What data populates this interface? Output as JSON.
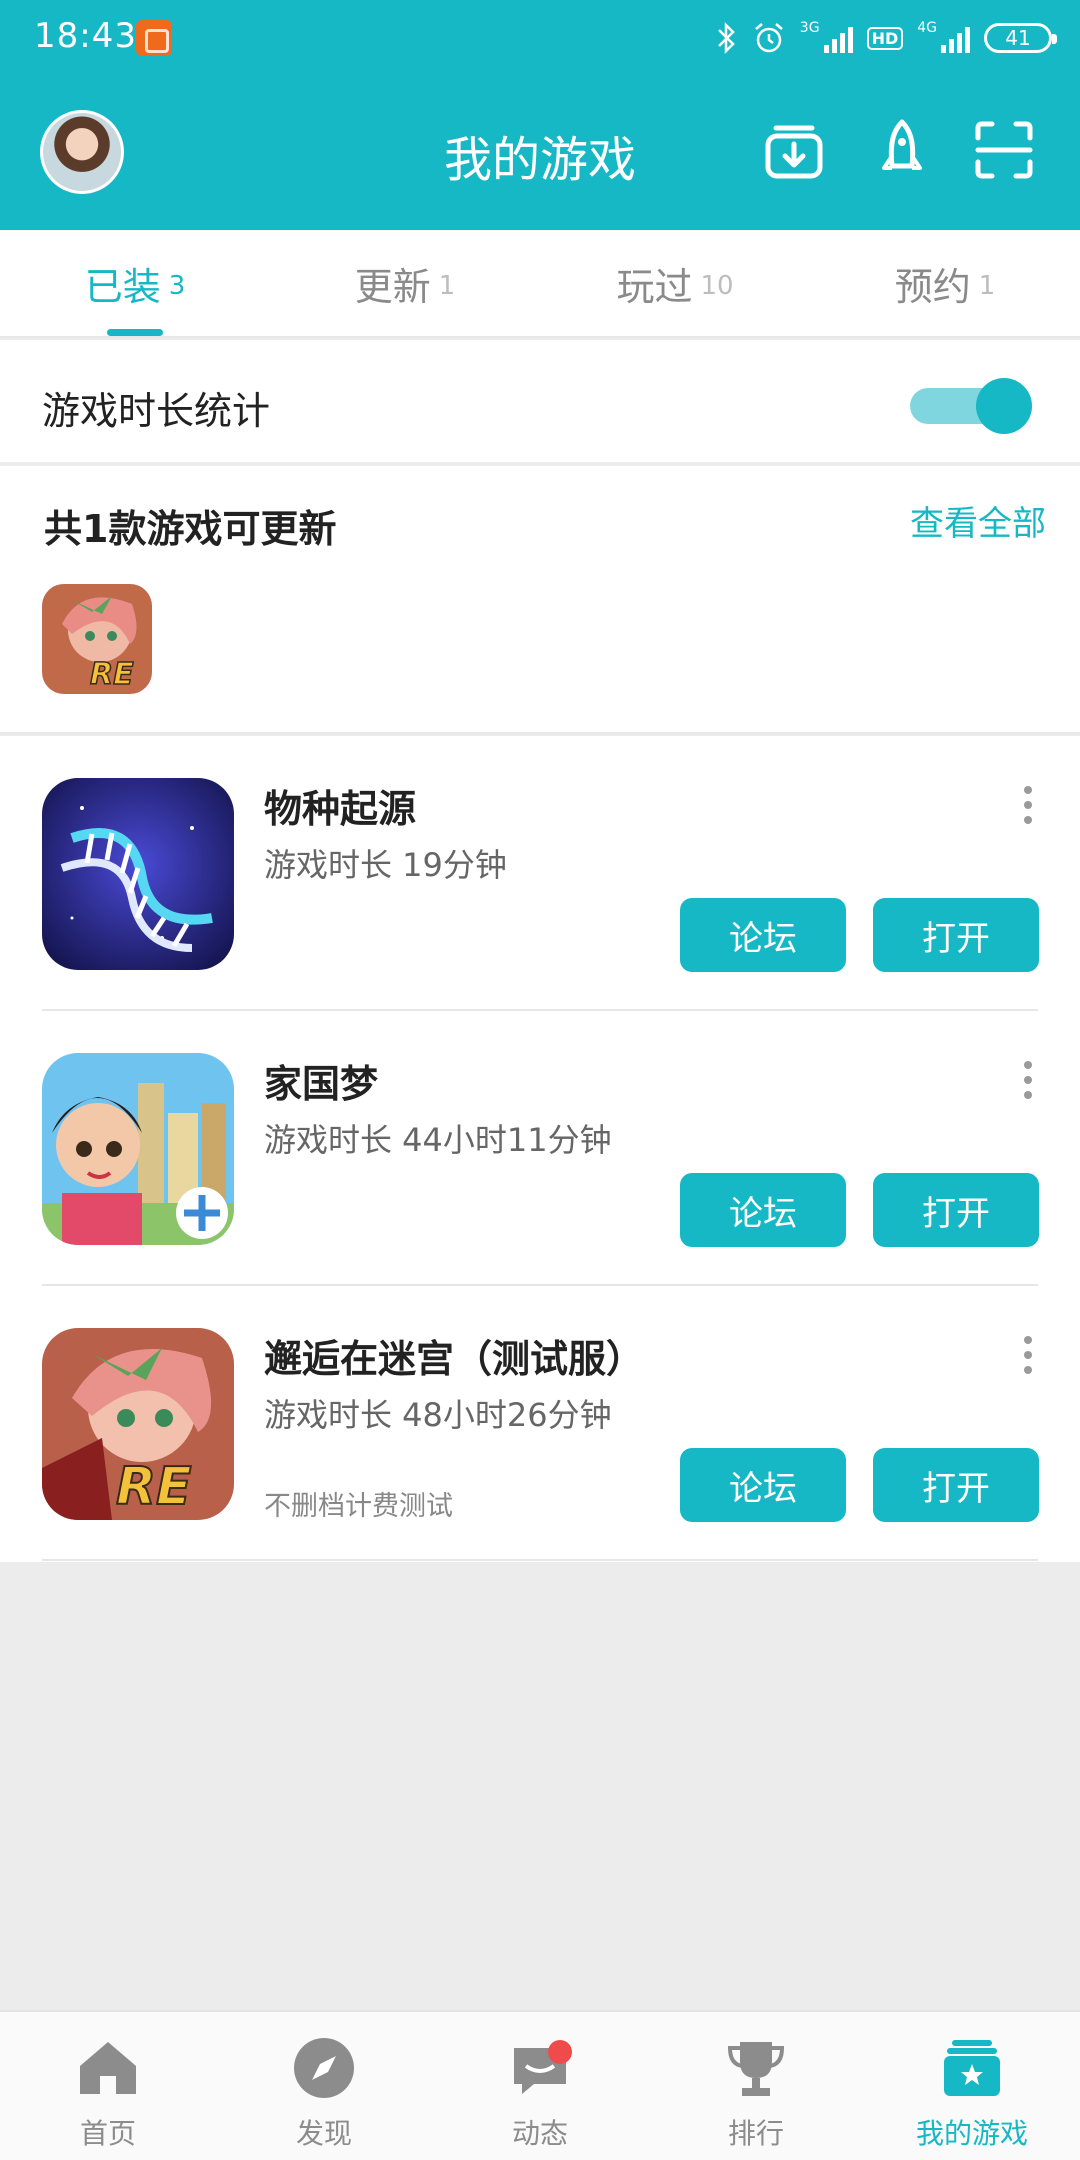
{
  "status_bar": {
    "time": "18:43",
    "network1": "3G",
    "hd": "HD",
    "network2": "4G",
    "battery": "41"
  },
  "app_bar": {
    "title": "我的游戏",
    "icons": [
      "download-manager-icon",
      "rocket-icon",
      "scan-icon"
    ]
  },
  "tabs": [
    {
      "label": "已装",
      "count": "3",
      "active": true
    },
    {
      "label": "更新",
      "count": "1",
      "active": false
    },
    {
      "label": "玩过",
      "count": "10",
      "active": false
    },
    {
      "label": "预约",
      "count": "1",
      "active": false
    }
  ],
  "playtime_stats": {
    "label": "游戏时长统计",
    "enabled": true
  },
  "updates": {
    "title": "共1款游戏可更新",
    "view_all": "查看全部"
  },
  "games": [
    {
      "name": "物种起源",
      "playtime": "游戏时长 19分钟",
      "note": "",
      "forum": "论坛",
      "open": "打开"
    },
    {
      "name": "家国梦",
      "playtime": "游戏时长 44小时11分钟",
      "note": "",
      "forum": "论坛",
      "open": "打开"
    },
    {
      "name": "邂逅在迷宫（测试服）",
      "playtime": "游戏时长 48小时26分钟",
      "note": "不删档计费测试",
      "forum": "论坛",
      "open": "打开"
    }
  ],
  "bottom_nav": [
    {
      "label": "首页",
      "icon": "home-icon"
    },
    {
      "label": "发现",
      "icon": "compass-icon"
    },
    {
      "label": "动态",
      "icon": "chat-icon"
    },
    {
      "label": "排行",
      "icon": "trophy-icon"
    },
    {
      "label": "我的游戏",
      "icon": "my-games-icon",
      "active": true
    }
  ],
  "colors": {
    "accent": "#16b8c5",
    "badge": "#f04b4b"
  }
}
